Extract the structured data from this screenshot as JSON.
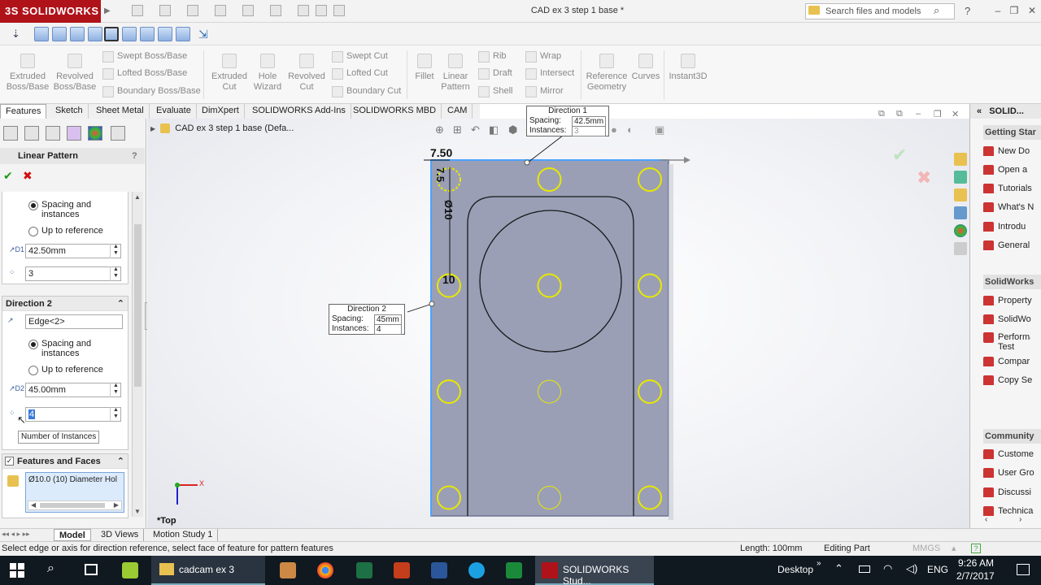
{
  "titlebar": {
    "logo": "3S SOLIDWORKS",
    "document_title": "CAD ex 3 step 1 base *",
    "search_placeholder": "Search files and models",
    "help": "?"
  },
  "command_manager": {
    "extruded_boss": "Extruded Boss/Base",
    "revolved_boss": "Revolved Boss/Base",
    "swept_boss": "Swept Boss/Base",
    "lofted_boss": "Lofted Boss/Base",
    "boundary_boss": "Boundary Boss/Base",
    "extruded_cut": "Extruded Cut",
    "hole_wizard": "Hole Wizard",
    "revolved_cut": "Revolved Cut",
    "swept_cut": "Swept Cut",
    "lofted_cut": "Lofted Cut",
    "boundary_cut": "Boundary Cut",
    "fillet": "Fillet",
    "linear_pattern": "Linear Pattern",
    "rib": "Rib",
    "draft": "Draft",
    "shell": "Shell",
    "wrap": "Wrap",
    "intersect": "Intersect",
    "mirror": "Mirror",
    "reference_geometry": "Reference Geometry",
    "curves": "Curves",
    "instant3d": "Instant3D"
  },
  "tabs": [
    "Features",
    "Sketch",
    "Sheet Metal",
    "Evaluate",
    "DimXpert",
    "SOLIDWORKS Add-Ins",
    "SOLIDWORKS MBD",
    "CAM"
  ],
  "property_manager": {
    "title": "Linear Pattern",
    "help": "?",
    "direction1": {
      "spacing_and_instances": "Spacing and instances",
      "up_to_reference": "Up to reference",
      "spacing": "42.50mm",
      "instances": "3"
    },
    "direction2": {
      "header": "Direction 2",
      "edge": "Edge<2>",
      "spacing_and_instances": "Spacing and instances",
      "up_to_reference": "Up to reference",
      "spacing": "45.00mm",
      "instances": "4",
      "tooltip": "Number of Instances"
    },
    "features_and_faces": {
      "header": "Features and Faces",
      "item": "Ø10.0 (10) Diameter Hol"
    }
  },
  "graphics": {
    "tree_item": "CAD ex 3 step 1 base  (Defa...",
    "callout1": {
      "title": "Direction 1",
      "spacing_label": "Spacing:",
      "spacing_value": "42.5mm",
      "instances_label": "Instances:",
      "instances_value": "3"
    },
    "callout2": {
      "title": "Direction 2",
      "spacing_label": "Spacing:",
      "spacing_value": "45mm",
      "instances_label": "Instances:",
      "instances_value": "4"
    },
    "dim_top": "7.50",
    "dim_side": "7.5",
    "dim_diameter": "Ø10",
    "dim_10": "10",
    "view_label": "*Top",
    "axis_x": "X"
  },
  "task_pane": {
    "title": "SOLID...",
    "getting_started": "Getting Star",
    "items1": [
      "New Do",
      "Open a",
      "Tutorials",
      "What's N",
      "Introdu",
      "General"
    ],
    "solidworks_head": "SolidWorks",
    "items2": [
      "Property",
      "SolidWo",
      "Performa Test",
      "Compar",
      "Copy Se"
    ],
    "community_head": "Community",
    "items3": [
      "Custome",
      "User Gro",
      "Discussi",
      "Technica"
    ]
  },
  "bottom_tabs": [
    "Model",
    "3D Views",
    "Motion Study 1"
  ],
  "status": {
    "message": "Select edge or axis for direction reference, select face of feature for pattern features",
    "length": "Length: 100mm",
    "mode": "Editing Part",
    "units": "MMGS"
  },
  "taskbar": {
    "folder": "cadcam ex 3",
    "app": "SOLIDWORKS Stud...",
    "desktop": "Desktop",
    "lang": "ENG",
    "time": "9:26 AM",
    "date": "2/7/2017"
  },
  "colors": {
    "brand": "#b0121a",
    "part": "#9a9fb6",
    "hole": "#e8e800",
    "accent": "#2a6fb8"
  }
}
